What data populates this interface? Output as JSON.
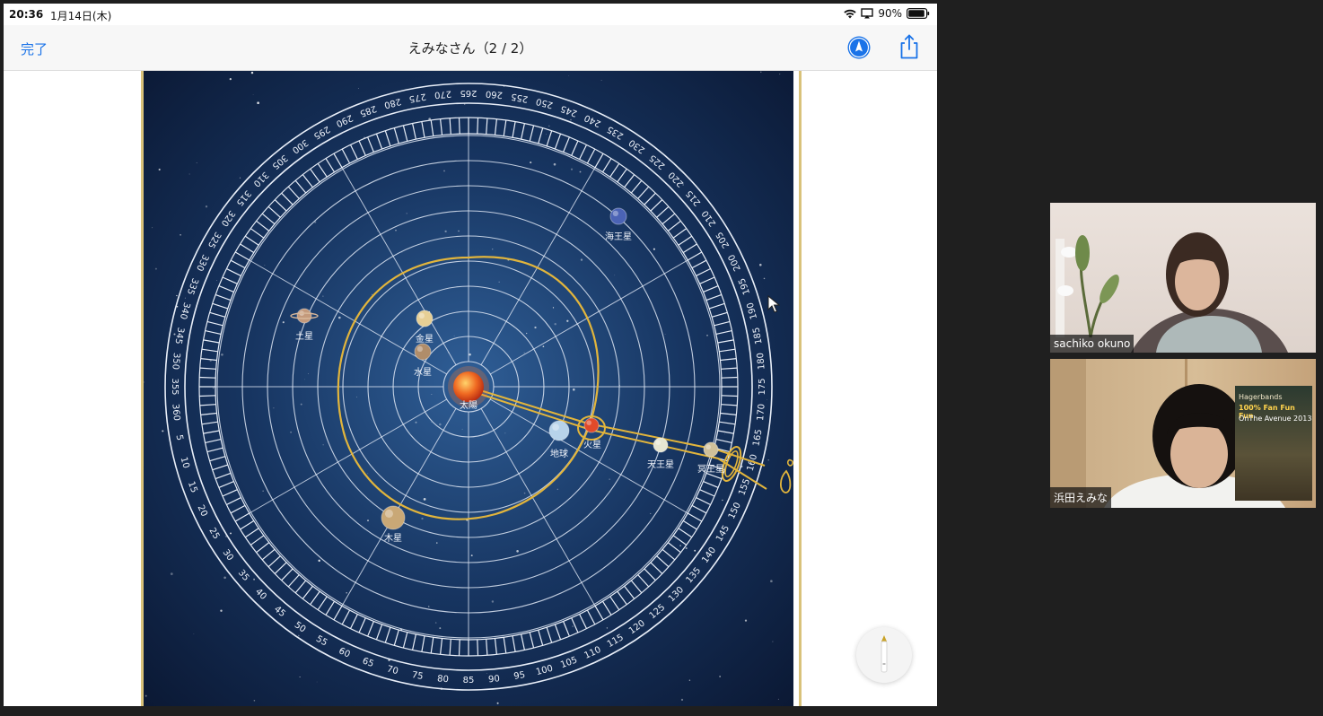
{
  "status_bar": {
    "time": "20:36",
    "date": "1月14日(木)",
    "battery": "90%"
  },
  "nav": {
    "done_label": "完了",
    "title": "えみなさん（2 / 2）"
  },
  "chart": {
    "degree_labels": [
      "265",
      "260",
      "255",
      "250",
      "245",
      "240",
      "235",
      "230",
      "225",
      "220",
      "215",
      "210",
      "205",
      "200",
      "195",
      "190",
      "185",
      "180",
      "175",
      "170",
      "165",
      "160",
      "155",
      "150",
      "145",
      "140",
      "135",
      "130",
      "125",
      "120",
      "115",
      "110",
      "105",
      "100",
      "95",
      "90",
      "85",
      "80",
      "75",
      "70",
      "65",
      "60",
      "55",
      "50",
      "45",
      "40",
      "35",
      "30",
      "25",
      "20",
      "15",
      "10",
      "5",
      "360",
      "355",
      "350",
      "345",
      "340",
      "335",
      "330",
      "325",
      "320",
      "315",
      "310",
      "305",
      "300",
      "295",
      "290",
      "285",
      "280",
      "275",
      "270"
    ],
    "planets": [
      {
        "name": "太陽",
        "color": "#e8451a",
        "r": 17
      },
      {
        "name": "水星",
        "color": "#b08d6a",
        "r": 9
      },
      {
        "name": "金星",
        "color": "#e6cf95",
        "r": 9
      },
      {
        "name": "地球",
        "color": "#b7d3ea",
        "r": 11
      },
      {
        "name": "火星",
        "color": "#e04a2a",
        "r": 8
      },
      {
        "name": "木星",
        "color": "#c9a876",
        "r": 13
      },
      {
        "name": "土星",
        "color": "#c49a7c",
        "r": 8
      },
      {
        "name": "天王星",
        "color": "#e6e6d2",
        "r": 8
      },
      {
        "name": "海王星",
        "color": "#4b63b5",
        "r": 9
      },
      {
        "name": "冥王星",
        "color": "#cfc09a",
        "r": 8
      }
    ],
    "annotation_color": "#e2b53c"
  },
  "participants": [
    {
      "name": "sachiko okuno"
    },
    {
      "name": "浜田えみな"
    }
  ],
  "poster": {
    "line1": "Hagerbands",
    "line2": "100% Fan Fun Fun",
    "line3": "OnThe Avenue 2013"
  }
}
